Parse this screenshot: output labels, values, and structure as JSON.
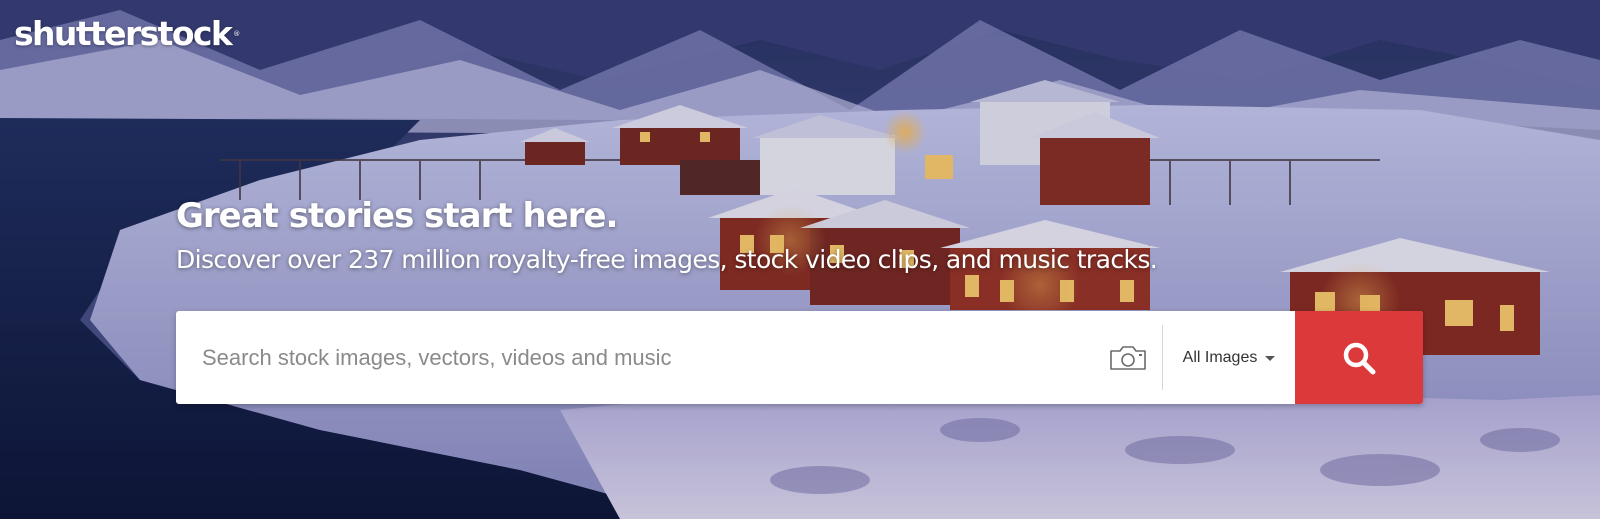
{
  "brand": {
    "logo_text": "shutterstock",
    "logo_mark": "®"
  },
  "hero": {
    "headline": "Great stories start here.",
    "subheadline": "Discover over 237 million royalty-free images, stock video clips, and music tracks.",
    "background": "snowy-fishing-village-at-dusk"
  },
  "search": {
    "placeholder": "Search stock images, vectors, videos and music",
    "value": "",
    "camera_icon": "camera-icon",
    "filter_label": "All Images",
    "filter_icon": "caret-down-icon",
    "submit_icon": "search-icon"
  },
  "colors": {
    "search_button": "#dc3a3a",
    "text_on_hero": "#ffffff"
  }
}
